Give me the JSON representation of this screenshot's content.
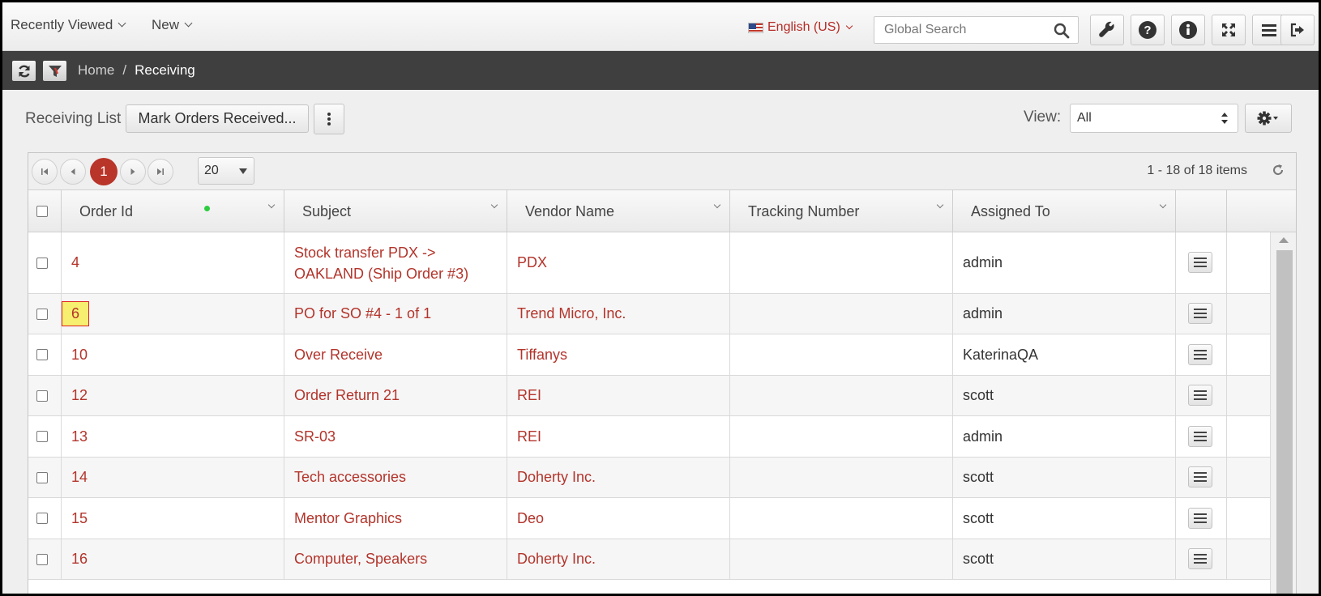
{
  "topbar": {
    "recently_viewed": "Recently Viewed",
    "new": "New",
    "language": "English (US)",
    "search_placeholder": "Global Search"
  },
  "breadcrumb": {
    "home": "Home",
    "separator": "/",
    "current": "Receiving"
  },
  "toolbar": {
    "list_label": "Receiving List",
    "mark_received_label": "Mark Orders Received...",
    "view_label": "View:",
    "view_value": "All"
  },
  "pager": {
    "current_page": "1",
    "page_size": "20",
    "info": "1 - 18 of 18 items"
  },
  "columns": [
    "Order Id",
    "Subject",
    "Vendor Name",
    "Tracking Number",
    "Assigned To"
  ],
  "rows": [
    {
      "order_id": "4",
      "subject_line1": "Stock transfer PDX ->",
      "subject_line2": "OAKLAND (Ship Order #3)",
      "vendor": "PDX",
      "tracking": "",
      "assigned": "admin"
    },
    {
      "order_id": "6",
      "subject": "PO for SO #4 - 1 of 1",
      "vendor": "Trend Micro, Inc.",
      "tracking": "",
      "assigned": "admin"
    },
    {
      "order_id": "10",
      "subject": "Over Receive",
      "vendor": "Tiffanys",
      "tracking": "",
      "assigned": "KaterinaQA"
    },
    {
      "order_id": "12",
      "subject": "Order Return 21",
      "vendor": "REI",
      "tracking": "",
      "assigned": "scott"
    },
    {
      "order_id": "13",
      "subject": "SR-03",
      "vendor": "REI",
      "tracking": "",
      "assigned": "admin"
    },
    {
      "order_id": "14",
      "subject": "Tech accessories",
      "vendor": "Doherty Inc.",
      "tracking": "",
      "assigned": "scott"
    },
    {
      "order_id": "15",
      "subject": "Mentor Graphics",
      "vendor": "Deo",
      "tracking": "",
      "assigned": "scott"
    },
    {
      "order_id": "16",
      "subject": "Computer, Speakers",
      "vendor": "Doherty Inc.",
      "tracking": "",
      "assigned": "scott"
    }
  ],
  "colors": {
    "accent": "#b3342b",
    "crumb_bar": "#3f3f3f",
    "highlight": "#f6ef70",
    "sort_indicator": "#2ecc40"
  },
  "icons": [
    "chevron-down-icon",
    "flag-us-icon",
    "search-icon",
    "wrench-icon",
    "help-icon",
    "info-icon",
    "expand-icon",
    "menu-icon",
    "logout-icon",
    "refresh-icon",
    "filter-icon",
    "kebab-icon",
    "gear-icon",
    "first-page-icon",
    "prev-page-icon",
    "next-page-icon",
    "last-page-icon",
    "row-menu-icon"
  ]
}
